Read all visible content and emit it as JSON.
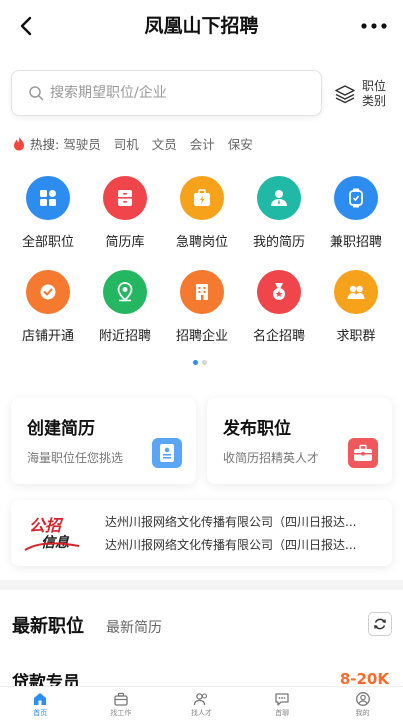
{
  "header": {
    "title": "凤凰山下招聘"
  },
  "search": {
    "placeholder": "搜索期望职位/企业"
  },
  "category": {
    "label": "职位类别"
  },
  "hot": {
    "label": "热搜:",
    "items": [
      "驾驶员",
      "司机",
      "文员",
      "会计",
      "保安"
    ]
  },
  "grid": {
    "items": [
      {
        "label": "全部职位",
        "icon": "grid-icon",
        "color": "#2d8cf0"
      },
      {
        "label": "简历库",
        "icon": "cabinet-icon",
        "color": "#f0454a"
      },
      {
        "label": "急聘岗位",
        "icon": "briefcase-bolt-icon",
        "color": "#f7a21b"
      },
      {
        "label": "我的简历",
        "icon": "person-icon",
        "color": "#1fb9a6"
      },
      {
        "label": "兼职招聘",
        "icon": "watch-icon",
        "color": "#2d8cf0"
      },
      {
        "label": "店铺开通",
        "icon": "check-icon",
        "color": "#f57a30"
      },
      {
        "label": "附近招聘",
        "icon": "location-icon",
        "color": "#25b661"
      },
      {
        "label": "招聘企业",
        "icon": "building-icon",
        "color": "#f57a30"
      },
      {
        "label": "名企招聘",
        "icon": "medal-icon",
        "color": "#f0454a"
      },
      {
        "label": "求职群",
        "icon": "group-icon",
        "color": "#f7a21b"
      }
    ]
  },
  "cards": {
    "create": {
      "title": "创建简历",
      "subtitle": "海量职位任您挑选"
    },
    "post": {
      "title": "发布职位",
      "subtitle": "收简历招精英人才"
    }
  },
  "banner": {
    "logo_line1": "公招",
    "logo_line2": "信息",
    "line1": "达州川报网络文化传播有限公司（四川日报达...",
    "line2": "达州川报网络文化传播有限公司（四川日报达..."
  },
  "tabs": {
    "latest_jobs": "最新职位",
    "latest_resumes": "最新简历"
  },
  "job": {
    "title": "贷款专员",
    "salary": "8-20K"
  },
  "nav": {
    "items": [
      {
        "label": "首页",
        "icon": "home-icon"
      },
      {
        "label": "找工作",
        "icon": "briefcase-icon"
      },
      {
        "label": "找人才",
        "icon": "people-icon"
      },
      {
        "label": "首聊",
        "icon": "chat-icon"
      },
      {
        "label": "我的",
        "icon": "user-icon"
      }
    ]
  },
  "colors": {
    "accent": "#2b8ef0",
    "salary": "#ff6a2a"
  }
}
